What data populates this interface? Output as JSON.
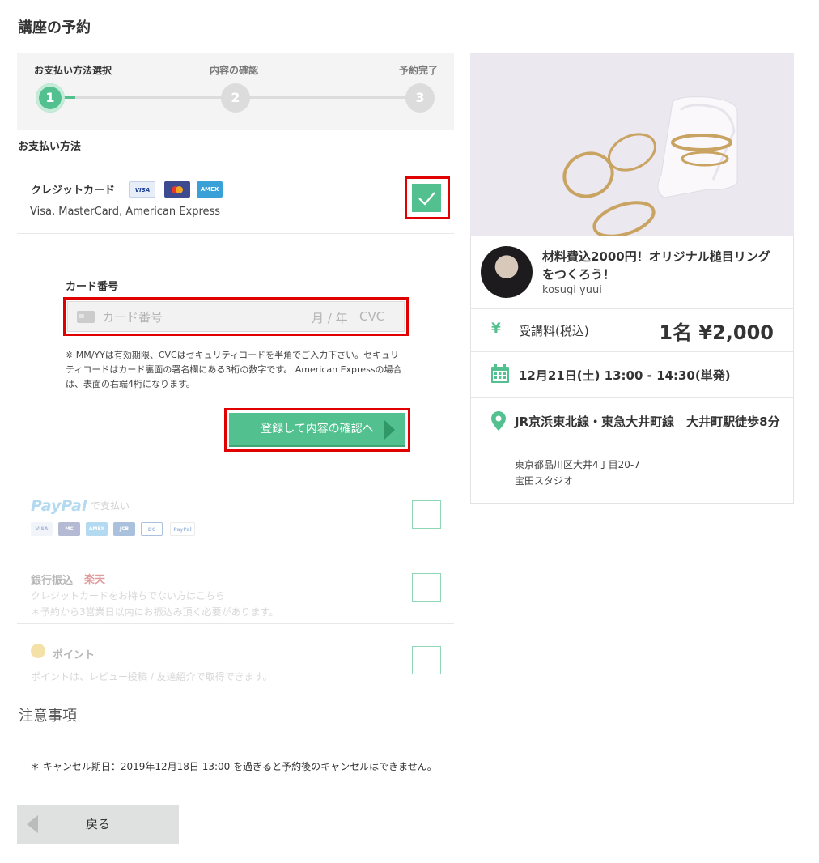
{
  "page": {
    "title": "講座の予約"
  },
  "stepper": {
    "steps": [
      {
        "label": "お支払い方法選択",
        "number": "1",
        "active": true
      },
      {
        "label": "内容の確認",
        "number": "2",
        "active": false
      },
      {
        "label": "予約完了",
        "number": "3",
        "active": false
      }
    ]
  },
  "payment": {
    "section_label": "お支払い方法",
    "credit_card": {
      "title": "クレジットカード",
      "brands": [
        "VISA",
        "MasterCard",
        "AMEX"
      ],
      "accepted": "Visa, MasterCard, American Express",
      "selected": true
    },
    "card_form": {
      "label": "カード番号",
      "placeholder": "カード番号",
      "expiry_placeholder": "月 / 年",
      "cvc_placeholder": "CVC",
      "note": "※ MM/YYは有効期限、CVCはセキュリティコードを半角でご入力下さい。セキュリティコードはカード裏面の署名欄にある3桁の数字です。 American Expressの場合は、表面の右端4桁になります。",
      "submit_label": "登録して内容の確認へ"
    },
    "paypal": {
      "logo_pay": "Pay",
      "logo_pal": "Pal",
      "suffix": "で支払い",
      "brands": [
        "VISA",
        "MC",
        "AMEX",
        "JCB",
        "DC",
        "PayPal"
      ]
    },
    "bank": {
      "title": "銀行振込",
      "bank_name": "楽天",
      "line1": "クレジットカードをお持ちでない方はこちら",
      "line2": "＊予約から3営業日以内にお振込み頂く必要があります。"
    },
    "points": {
      "title": "ポイント",
      "desc": "ポイントは、レビュー投稿 / 友達紹介で取得できます。"
    }
  },
  "notes": {
    "title": "注意事項",
    "text": "＊ キャンセル期日：2019年12月18日 13:00 を過ぎると予約後のキャンセルはできません。"
  },
  "back_label": "戻る",
  "course": {
    "title": "材料費込2000円！オリジナル槌目リングをつくろう！",
    "teacher": "kosugi yuui",
    "yen_symbol": "¥",
    "fee_label": "受講料(税込)",
    "price": "1名 ¥2,000",
    "date": "12月21日(土) 13:00 - 14:30(単発)",
    "station": "JR京浜東北線・東急大井町線　大井町駅徒歩8分",
    "address_line1": "東京都品川区大井4丁目20-7",
    "address_line2": "宝田スタジオ"
  },
  "colors": {
    "accent": "#52c08f",
    "highlight": "#e00000"
  }
}
